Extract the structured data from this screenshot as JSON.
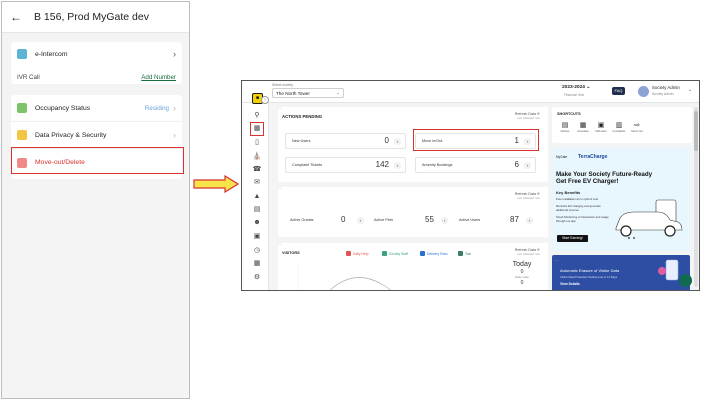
{
  "phone": {
    "title": "B 156, Prod MyGate dev",
    "intercom_label": "e-Intercom",
    "ivr_label": "IVR Call",
    "add_number_label": "Add Number",
    "occupancy_label": "Occupancy Status",
    "occupancy_status": "Residing",
    "privacy_label": "Data Privacy & Security",
    "moveout_label": "Move-out/Delete"
  },
  "dashboard": {
    "society_caption": "Select society",
    "society_name": "The North Tower",
    "fy_label": "2023-2024",
    "fy_sub": "Financial Year",
    "faq_label": "FAQ",
    "user_name": "Society Admin",
    "user_role": "Society Admin",
    "actions_title": "ACTIONS PENDING",
    "refresh_label": "Refresh Data",
    "refresh_sub": "Last refreshed: now",
    "tiles": [
      {
        "label": "New Users",
        "value": "0"
      },
      {
        "label": "Move in/Out",
        "value": "1"
      },
      {
        "label": "Complaint Tickets",
        "value": "142"
      },
      {
        "label": "Amenity Bookings",
        "value": "6"
      }
    ],
    "mini_tiles": [
      {
        "label": "Active Guests",
        "value": "0"
      },
      {
        "label": "Active Pets",
        "value": "55"
      },
      {
        "label": "Active Users",
        "value": "87"
      }
    ],
    "visitors_title": "VISITORS",
    "legend": [
      {
        "label": "Daily Help",
        "color": "#e05555"
      },
      {
        "label": "Society Staff",
        "color": "#3ca37a"
      },
      {
        "label": "Delivery Exec",
        "color": "#2d6fd1"
      },
      {
        "label": "Taxi",
        "color": "#3b7b6a"
      }
    ],
    "today_label": "Today",
    "today_value": "0",
    "today_sub": "Daily Help",
    "today_value2": "0",
    "shortcuts_title": "SHORTCUTS",
    "shortcuts": [
      {
        "label": "Notices",
        "icon": "notice-icon"
      },
      {
        "label": "Amenities",
        "icon": "amenity-icon"
      },
      {
        "label": "Add users",
        "icon": "add-user-icon"
      },
      {
        "label": "Complaints",
        "icon": "complaint-icon"
      },
      {
        "label": "Move Out",
        "icon": "move-out-icon"
      }
    ],
    "ad_brand": "MyGate",
    "ad_brand2": "TerraCharge",
    "ad_headline": "Make Your Society Future-Ready Get Free EV Charger!",
    "ad_key_benefits": "Key Benefits",
    "ad_bullets": [
      "Free installation at no upfront cost",
      "Monetize EV charging and generate additional revenue",
      "Smart Monitoring of transaction and usage through our app"
    ],
    "ad_button": "Start Earning!",
    "ad2_title": "Automatic Erasure of Visitor Data",
    "ad2_sub": "Visitor Data Protection Setting Live in 14 Days",
    "ad2_link": "View Details"
  }
}
